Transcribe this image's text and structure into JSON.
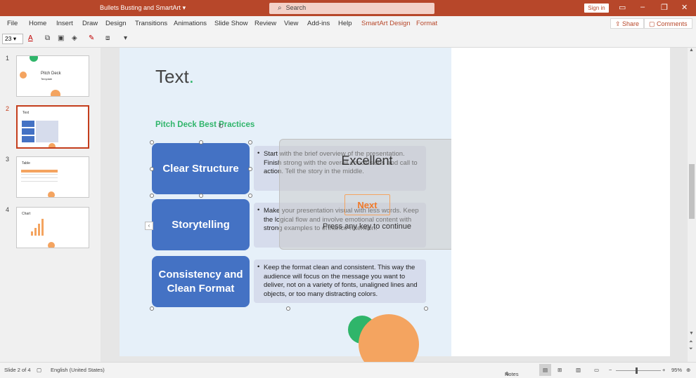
{
  "window": {
    "title": "Bullets Busting and SmartArt",
    "title_suffix": "▾",
    "search_placeholder": "Search",
    "signin": "Sign in"
  },
  "menu": {
    "tabs": [
      "File",
      "Home",
      "Insert",
      "Draw",
      "Design",
      "Transitions",
      "Animations",
      "Slide Show",
      "Review",
      "View",
      "Add-ins",
      "Help",
      "SmartArt Design",
      "Format"
    ],
    "share": "Share",
    "comments": "Comments"
  },
  "ribbon": {
    "font_size": "23"
  },
  "thumbnails": [
    {
      "num": "1",
      "label": "Pitch Deck",
      "sub": "Template"
    },
    {
      "num": "2",
      "label": "Text"
    },
    {
      "num": "3",
      "label": "Table"
    },
    {
      "num": "4",
      "label": "Chart"
    }
  ],
  "slide": {
    "title": "Text",
    "title_dot": "●",
    "subtitle": "Pitch Deck Best Practices",
    "items": [
      {
        "heading": "Clear Structure",
        "text": "Start with the brief overview of the presentation. Finish strong with the overall conclusions and call to action. Tell the story in the middle."
      },
      {
        "heading": "Storytelling",
        "text": "Make your presentation visual with less words. Keep the logical flow and involve emotional content with strong examples to enhance retention."
      },
      {
        "heading": "Consistency and Clean Format",
        "text": "Keep the format clean and consistent. This way the audience will focus on the message you want to deliver, not on a variety of fonts, unaligned lines and objects, or too many distracting colors."
      }
    ]
  },
  "overlay": {
    "title": "Excellent",
    "button": "Next",
    "hint": "Press any key to continue"
  },
  "status": {
    "slide": "Slide 2 of 4",
    "language": "English (United States)",
    "notes": "Notes",
    "zoom": "95%"
  },
  "colors": {
    "accent": "#b7472a",
    "smartart_blue": "#4472c4",
    "green": "#2fb56a",
    "orange": "#f4a460"
  }
}
